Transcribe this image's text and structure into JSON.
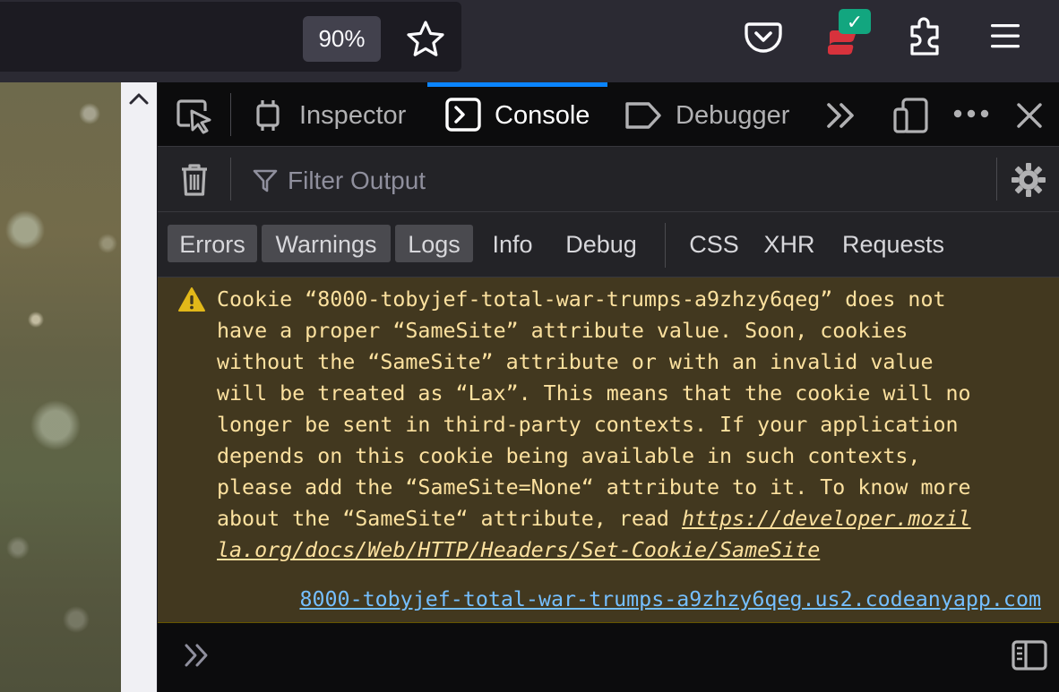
{
  "browser": {
    "zoom_level": "90%",
    "icons": [
      "bookmark-star-icon",
      "pocket-icon",
      "extension-badge-icon",
      "extensions-icon",
      "hamburger-menu-icon"
    ]
  },
  "devtools": {
    "tabs": [
      {
        "label": "Inspector",
        "icon": "inspector-icon"
      },
      {
        "label": "Console",
        "icon": "console-icon",
        "selected": true
      },
      {
        "label": "Debugger",
        "icon": "debugger-icon"
      }
    ],
    "filter": {
      "placeholder": "Filter Output"
    },
    "levels": [
      {
        "label": "Errors",
        "active": true
      },
      {
        "label": "Warnings",
        "active": true
      },
      {
        "label": "Logs",
        "active": true
      },
      {
        "label": "Info",
        "active": false
      },
      {
        "label": "Debug",
        "active": false
      }
    ],
    "types": [
      {
        "label": "CSS"
      },
      {
        "label": "XHR"
      },
      {
        "label": "Requests"
      }
    ],
    "message": {
      "level": "warning",
      "lines": [
        "Cookie “8000-tobyjef-total-war-trumps-a9zhzy6qeg” does not",
        "have a proper “SameSite” attribute value. Soon, cookies",
        "without the “SameSite” attribute or with an invalid value",
        "will be treated as “Lax”. This means that the cookie will no",
        "longer be sent in third-party contexts. If your application",
        "depends on this cookie being available in such contexts,",
        "please add the “SameSite=None“ attribute to it. To know more",
        "about the “SameSite“ attribute, read "
      ],
      "link_line1": "https://developer.mozil",
      "link_line2": "la.org/docs/Web/HTTP/Headers/Set-Cookie/SameSite",
      "source": "8000-tobyjef-total-war-trumps-a9zhzy6qeg.us2.codeanyapp.com"
    },
    "colors": {
      "accent": "#0a84ff",
      "warning_bg": "#42381f",
      "warning_text": "#fce19f",
      "link": "#75bfff"
    }
  }
}
